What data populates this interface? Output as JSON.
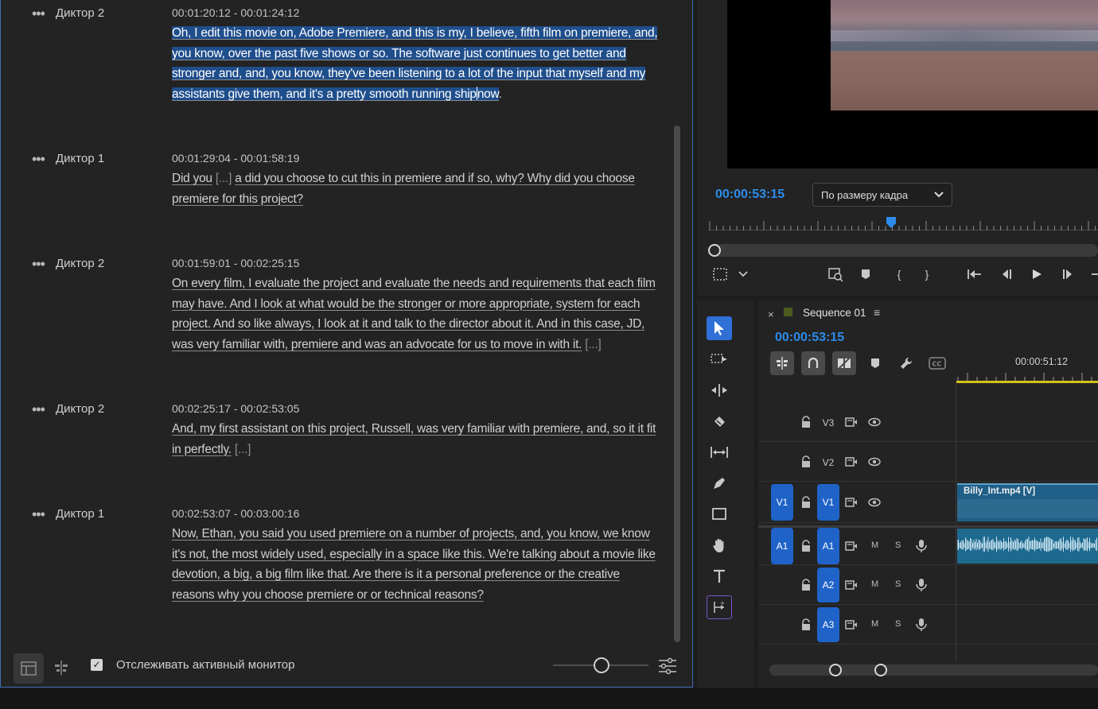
{
  "transcript": {
    "segments": [
      {
        "speaker": "Диктор 2",
        "time": "00:01:20:12 - 00:01:24:12",
        "selected_text": " Oh, I edit this movie on, Adobe Premiere, and this is my, I believe, fifth film on premiere, and, you know, over the past five shows or so. The software just continues to get better and stronger and, and, you know, they've been listening to a lot of the input that myself and my assistants give them, and it's a pretty smooth running ship",
        "text_after_cursor": "now",
        "end": "."
      },
      {
        "speaker": "Диктор 1",
        "time": "00:01:29:04 - 00:01:58:19",
        "text": "Did you",
        "gap": "[...]",
        "text_after_gap": "a did you choose to cut this in premiere and if so, why? Why did you choose premiere for this project?"
      },
      {
        "speaker": "Диктор 2",
        "time": "00:01:59:01 - 00:02:25:15",
        "text": "On every film, I evaluate the project and evaluate the needs and requirements that each film may have. And I look at what would be the stronger or more appropriate, system for each project. And so like always, I look at it and talk to the director about it. And in this case, JD, was very familiar with, premiere and was an advocate for us to move in with it.",
        "gap": "[...]"
      },
      {
        "speaker": "Диктор 2",
        "time": "00:02:25:17 - 00:02:53:05",
        "text": "And, my first assistant on this project, Russell, was very familiar with premiere, and, so it it fit in perfectly.",
        "gap": "[...]"
      },
      {
        "speaker": "Диктор 1",
        "time": "00:02:53:07 - 00:03:00:16",
        "text": "Now, Ethan, you said you used premiere on a number of projects, and, you know, we know it's not, the most widely used, especially in a space like this. We're talking about a movie like devotion, a big, a big film like that. Are there is it a personal preference or the creative reasons why you choose premiere or or technical reasons?"
      }
    ],
    "footer": {
      "follow_monitor_label": "Отслеживать активный монитор",
      "follow_monitor_checked": true
    },
    "more_glyph": "•••"
  },
  "monitor": {
    "timecode": "00:00:53:15",
    "zoom_value": "По размеру кадра"
  },
  "timeline": {
    "sequence_name": "Sequence 01",
    "timecode": "00:00:53:15",
    "ruler_time": "00:00:51:12",
    "tracks": {
      "v3": "V3",
      "v2": "V2",
      "v1_target": "V1",
      "v1": "V1",
      "a1_target": "A1",
      "a1": "A1",
      "a2": "A2",
      "a3": "A3",
      "mute": "M",
      "solo": "S"
    },
    "clip_name": "Billy_Int.mp4 [V]",
    "cc_label": "CC"
  },
  "colors": {
    "accent": "#2d8ceb",
    "selection": "#1f4e8c",
    "track_target": "#1f63c9",
    "playhead_line": "#d4c21a"
  }
}
